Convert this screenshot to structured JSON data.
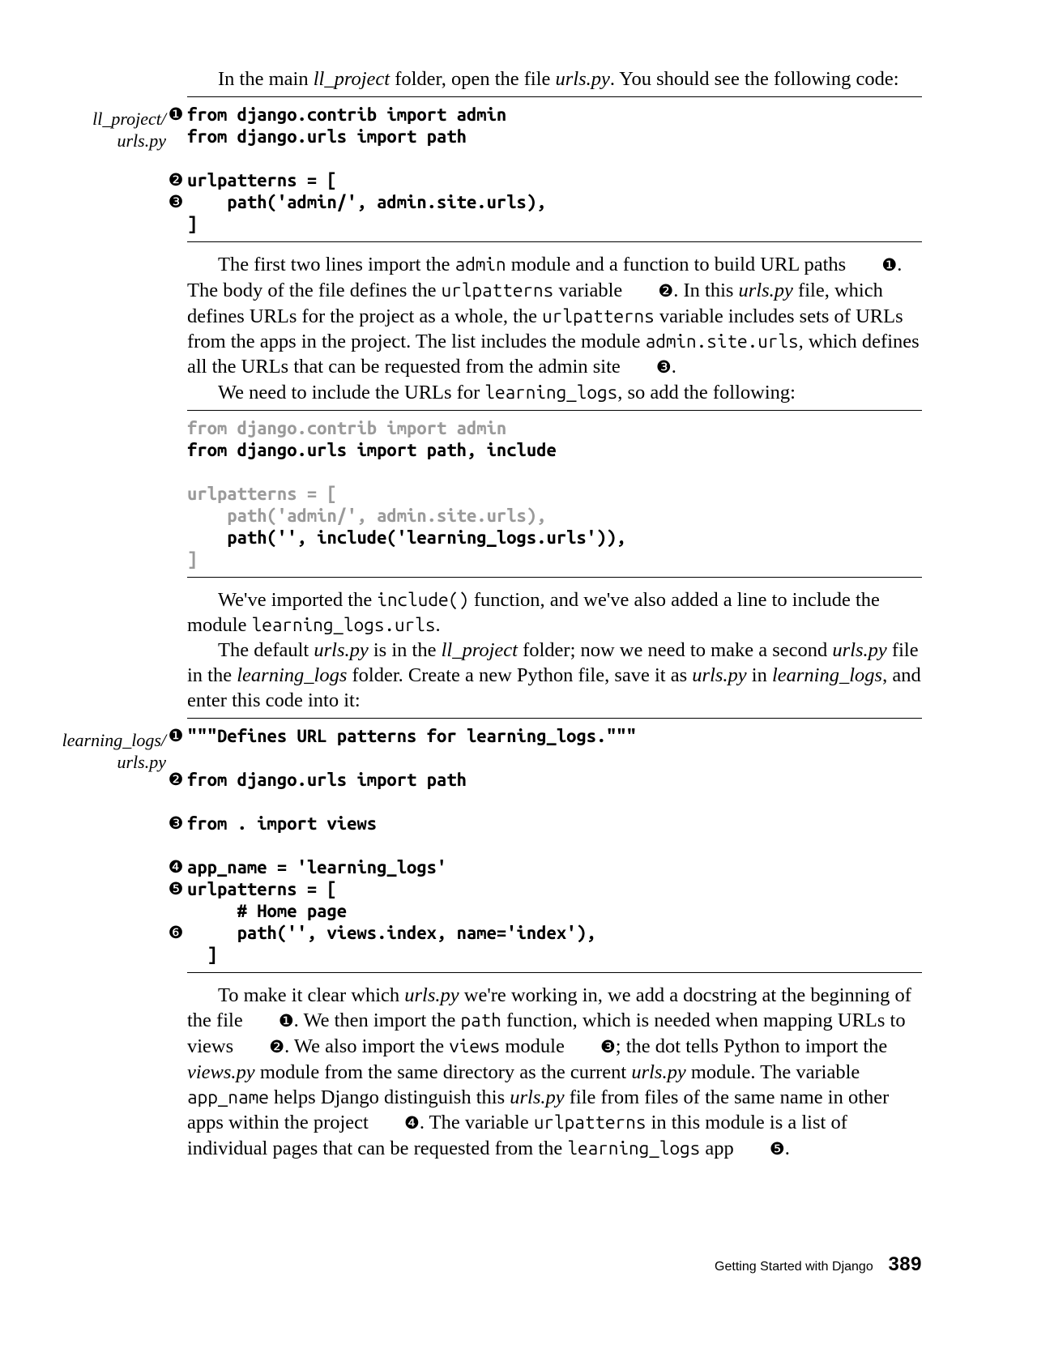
{
  "para1_a": "In the main ",
  "para1_b": "ll_project",
  "para1_c": " folder, open the file ",
  "para1_d": "urls.py",
  "para1_e": ". You should see the following code:",
  "label1_a": "ll_project/",
  "label1_b": "urls.py",
  "m1": "❶",
  "m2": "❷",
  "m3": "❸",
  "m4": "❹",
  "m5": "❺",
  "m6": "❻",
  "code1": {
    "l1": "from django.contrib import admin",
    "l2": "from django.urls import path",
    "l3": "urlpatterns = [",
    "l4": "    path('admin/', admin.site.urls),",
    "l5": "]"
  },
  "para2_a": "The first two lines import the ",
  "para2_b": "admin",
  "para2_c": " module and a function to build URL paths ",
  "para2_d": ". The body of the file defines the ",
  "para2_e": "urlpatterns",
  "para2_f": " variable ",
  "para2_g": ". In this ",
  "para2_h": "urls.py",
  "para2_i": " file, which defines URLs for the project as a whole, the ",
  "para2_j": "urlpatterns",
  "para2_k": " variable includes sets of URLs from the apps in the project. The list includes the module ",
  "para2_l": "admin.site.urls",
  "para2_m": ", which defines all the URLs that can be requested from the admin site ",
  "para2_n": ".",
  "para3_a": "We need to include the URLs for ",
  "para3_b": "learning_logs",
  "para3_c": ", so add the following:",
  "code2": {
    "l1": "from django.contrib import admin",
    "l2": "from django.urls import path, include",
    "l3": "urlpatterns = [",
    "l4": "    path('admin/', admin.site.urls),",
    "l5": "    path('', include('learning_logs.urls')),",
    "l6": "]"
  },
  "para4_a": "We've imported the ",
  "para4_b": "include()",
  "para4_c": " function, and we've also added a line to include the module ",
  "para4_d": "learning_logs.urls",
  "para4_e": ".",
  "para5_a": "The default ",
  "para5_b": "urls.py",
  "para5_c": " is in the ",
  "para5_d": "ll_project",
  "para5_e": " folder; now we need to make a second ",
  "para5_f": "urls.py",
  "para5_g": " file in the ",
  "para5_h": "learning_logs",
  "para5_i": " folder. Create a new Python file, save it as ",
  "para5_j": "urls.py",
  "para5_k": " in ",
  "para5_l": "learning_logs",
  "para5_m": ", and enter this code into it:",
  "label2_a": "learning_logs/",
  "label2_b": "urls.py",
  "code3": {
    "l1": "\"\"\"Defines URL patterns for learning_logs.\"\"\"",
    "l2": "from django.urls import path",
    "l3": "from . import views",
    "l4": "app_name = 'learning_logs'",
    "l5": "urlpatterns = [",
    "l6": "     # Home page",
    "l7": "     path('', views.index, name='index'),",
    "l8": "  ]"
  },
  "para6_a": "To make it clear which ",
  "para6_b": "urls.py",
  "para6_c": " we're working in, we add a docstring at the beginning of the file ",
  "para6_d": ". We then import the ",
  "para6_e": "path",
  "para6_f": " function, which is needed when mapping URLs to views ",
  "para6_g": ". We also import the ",
  "para6_h": "views",
  "para6_i": " module ",
  "para6_j": "; the dot tells Python to import the ",
  "para6_k": "views.py",
  "para6_l": " module from the same directory as the current ",
  "para6_m": "urls.py",
  "para6_n": " module. The variable ",
  "para6_o": "app_name",
  "para6_p": " helps Django distinguish this ",
  "para6_q": "urls.py",
  "para6_r": " file from files of the same name in other apps within the project ",
  "para6_s": ". The variable ",
  "para6_t": "urlpatterns",
  "para6_u": " in this module is a list of individual pages that can be requested from the ",
  "para6_v": "learning_logs",
  "para6_w": " app ",
  "para6_x": ".",
  "footer_title": "Getting Started with Django",
  "footer_page": "389"
}
